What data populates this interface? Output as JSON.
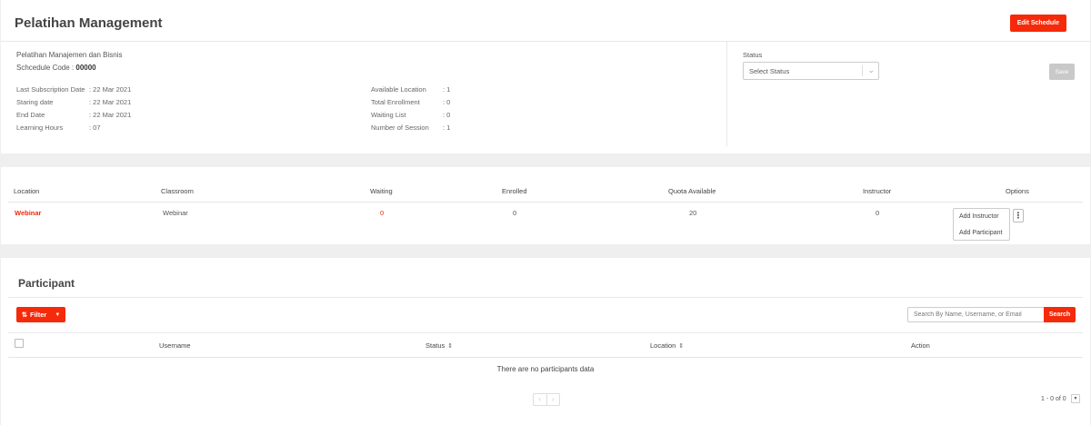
{
  "header": {
    "title": "Pelatihan Management",
    "edit_button": "Edit Schedule"
  },
  "course": {
    "name": "Pelatihan Manajemen dan Bisnis",
    "schedule_code_label": "Schcedule Code : ",
    "schedule_code": "00000"
  },
  "info_left": [
    {
      "label": "Last Subscription Date",
      "value": ":  22 Mar 2021"
    },
    {
      "label": "Staring date",
      "value": ":  22 Mar 2021"
    },
    {
      "label": "End Date",
      "value": ":  22 Mar 2021"
    },
    {
      "label": "Learning Hours",
      "value": ":  07"
    }
  ],
  "info_right": [
    {
      "label": "Available Location",
      "value": ":  1"
    },
    {
      "label": "Total Enrollment",
      "value": ":  0"
    },
    {
      "label": "Waiting List",
      "value": ":  0"
    },
    {
      "label": "Number of Session",
      "value": ":  1"
    }
  ],
  "status": {
    "label": "Status",
    "placeholder": "Select Status",
    "save_button": "Save"
  },
  "location_table": {
    "headers": [
      "Location",
      "Classroom",
      "Waiting",
      "Enrolled",
      "Quota Available",
      "Instructor",
      "Options"
    ],
    "row": {
      "location": "Webinar",
      "classroom": "Webinar",
      "waiting": "0",
      "enrolled": "0",
      "quota": "20",
      "instructor": "0"
    },
    "options_menu": [
      "Add Instructor",
      "Add Participant"
    ],
    "kebab_icon": "more-vertical-icon"
  },
  "participant": {
    "title": "Participant",
    "filter_button": "Filter",
    "filter_icon": "filter-icon",
    "search_placeholder": "Search By Name, Username, or Email",
    "search_button": "Search",
    "headers": [
      "Username",
      "Status",
      "Location",
      "Action"
    ],
    "empty_message": "There are no participants data",
    "page_info": "1 - 0 of 0"
  },
  "colors": {
    "accent": "#f52a0a",
    "disabled": "#c9c9c9"
  }
}
